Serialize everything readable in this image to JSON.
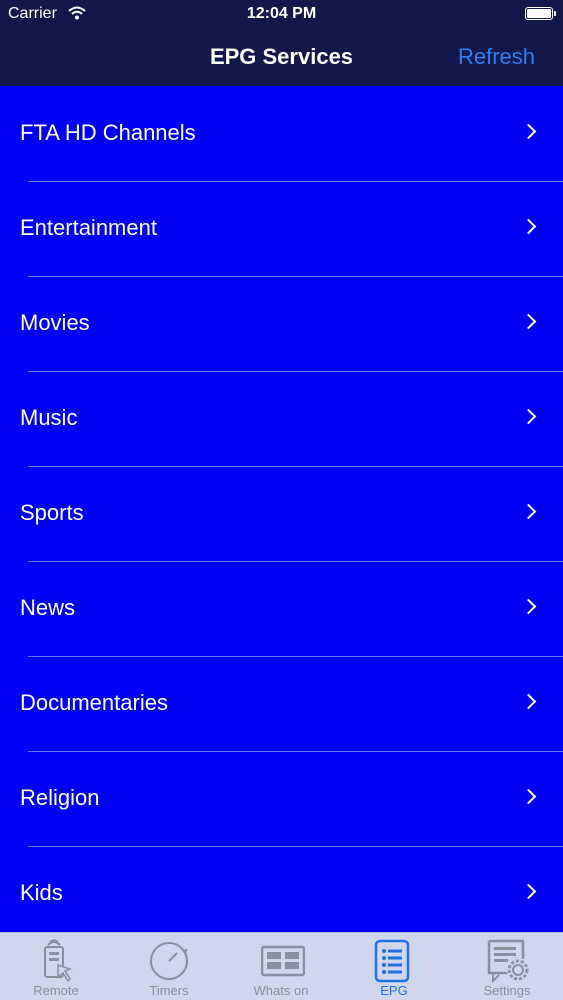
{
  "status_bar": {
    "carrier": "Carrier",
    "time": "12:04 PM"
  },
  "nav": {
    "title": "EPG Services",
    "refresh_label": "Refresh"
  },
  "list": {
    "items": [
      {
        "label": "FTA HD Channels"
      },
      {
        "label": "Entertainment"
      },
      {
        "label": "Movies"
      },
      {
        "label": "Music"
      },
      {
        "label": "Sports"
      },
      {
        "label": "News"
      },
      {
        "label": "Documentaries"
      },
      {
        "label": "Religion"
      },
      {
        "label": "Kids"
      }
    ]
  },
  "tabbar": {
    "tabs": [
      {
        "label": "Remote",
        "icon": "remote-icon"
      },
      {
        "label": "Timers",
        "icon": "timer-icon"
      },
      {
        "label": "Whats on",
        "icon": "whats-on-icon"
      },
      {
        "label": "EPG",
        "icon": "epg-list-icon",
        "active": true
      },
      {
        "label": "Settings",
        "icon": "settings-icon"
      }
    ]
  },
  "colors": {
    "nav_background": "#12194a",
    "list_background": "#0000f5",
    "accent": "#1f6fe5",
    "tabbar_background": "#d0d6ec"
  }
}
